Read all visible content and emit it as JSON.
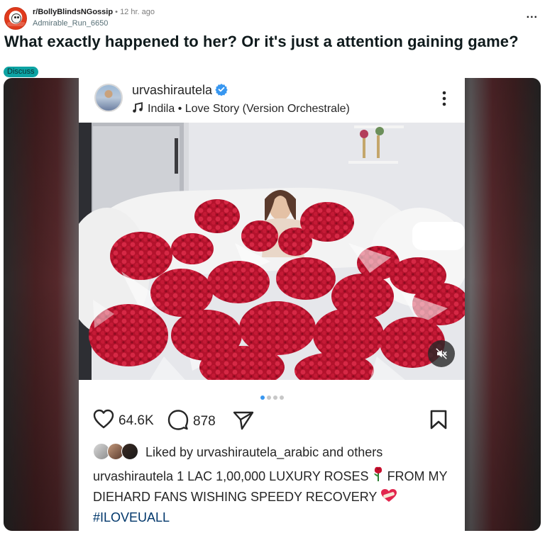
{
  "post": {
    "subreddit": "r/BollyBlindsNGossip",
    "separator": "•",
    "time": "12 hr. ago",
    "author": "Admirable_Run_6650",
    "more_label": "...",
    "title": "What exactly happened to her? Or it's just a attention gaining game?",
    "flair": "Discuss"
  },
  "instagram": {
    "username": "urvashirautela",
    "song": "Indila • Love Story (Version Orchestrale)",
    "likes": "64.6K",
    "comments": "878",
    "liked_by": "Liked by urvashirautela_arabic and others",
    "caption_user": "urvashirautela",
    "caption_part1": " 1 LAC 1,00,000 LUXURY ROSES ",
    "caption_part2": " FROM MY DIEHARD FANS WISHING SPEEDY RECOVERY ",
    "hashtag": "#ILOVEUALL",
    "carousel_count": 4,
    "carousel_active": 1
  },
  "colors": {
    "reddit_orange": "#e03a1c",
    "flair_teal": "#0ca3a3",
    "verified_blue": "#3897f0",
    "hashtag_blue": "#00376b",
    "rose_red": "#c8102e"
  },
  "icons": {
    "subreddit_avatar": "subreddit-avatar-icon",
    "verified": "verified-badge-icon",
    "music": "music-note-icon",
    "menu": "vertical-dots-icon",
    "mute": "speaker-muted-icon",
    "like": "heart-icon",
    "comment": "comment-bubble-icon",
    "share": "paper-plane-icon",
    "save": "bookmark-icon"
  }
}
